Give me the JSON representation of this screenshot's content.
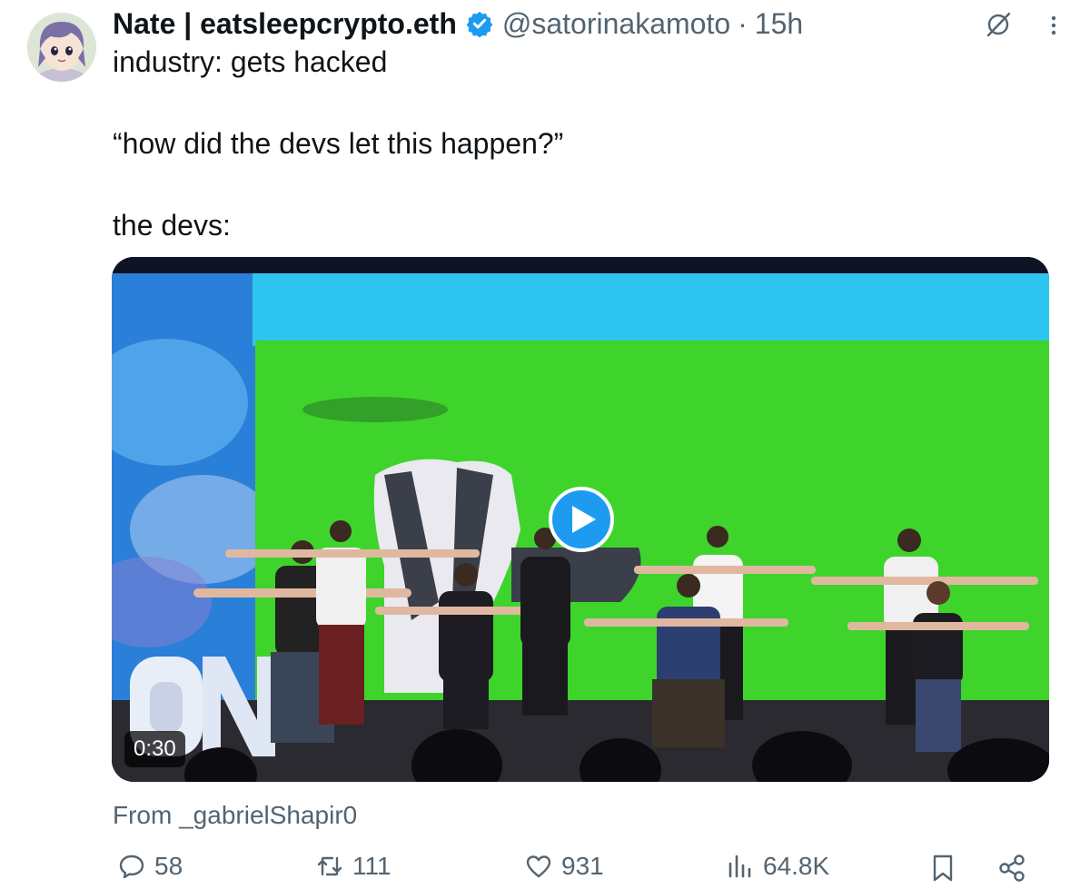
{
  "author": {
    "display_name": "Nate | eatsleepcrypto.eth",
    "handle": "@satorinakamoto",
    "separator": "·",
    "time_ago": "15h",
    "verified": true,
    "avatar_icon": "anime-avatar"
  },
  "tweet": {
    "lines": [
      "industry: gets hacked",
      "“how did the devs let this happen?”",
      "the devs:"
    ]
  },
  "media": {
    "type": "video",
    "duration": "0:30",
    "play_icon": "play-icon"
  },
  "source": {
    "text": "From _gabrielShapir0"
  },
  "actions": {
    "reply_count": "58",
    "retweet_count": "111",
    "like_count": "931",
    "views_count": "64.8K"
  },
  "colors": {
    "accent": "#1d9bf0",
    "secondary_text": "#536471",
    "primary_text": "#0f1419"
  }
}
